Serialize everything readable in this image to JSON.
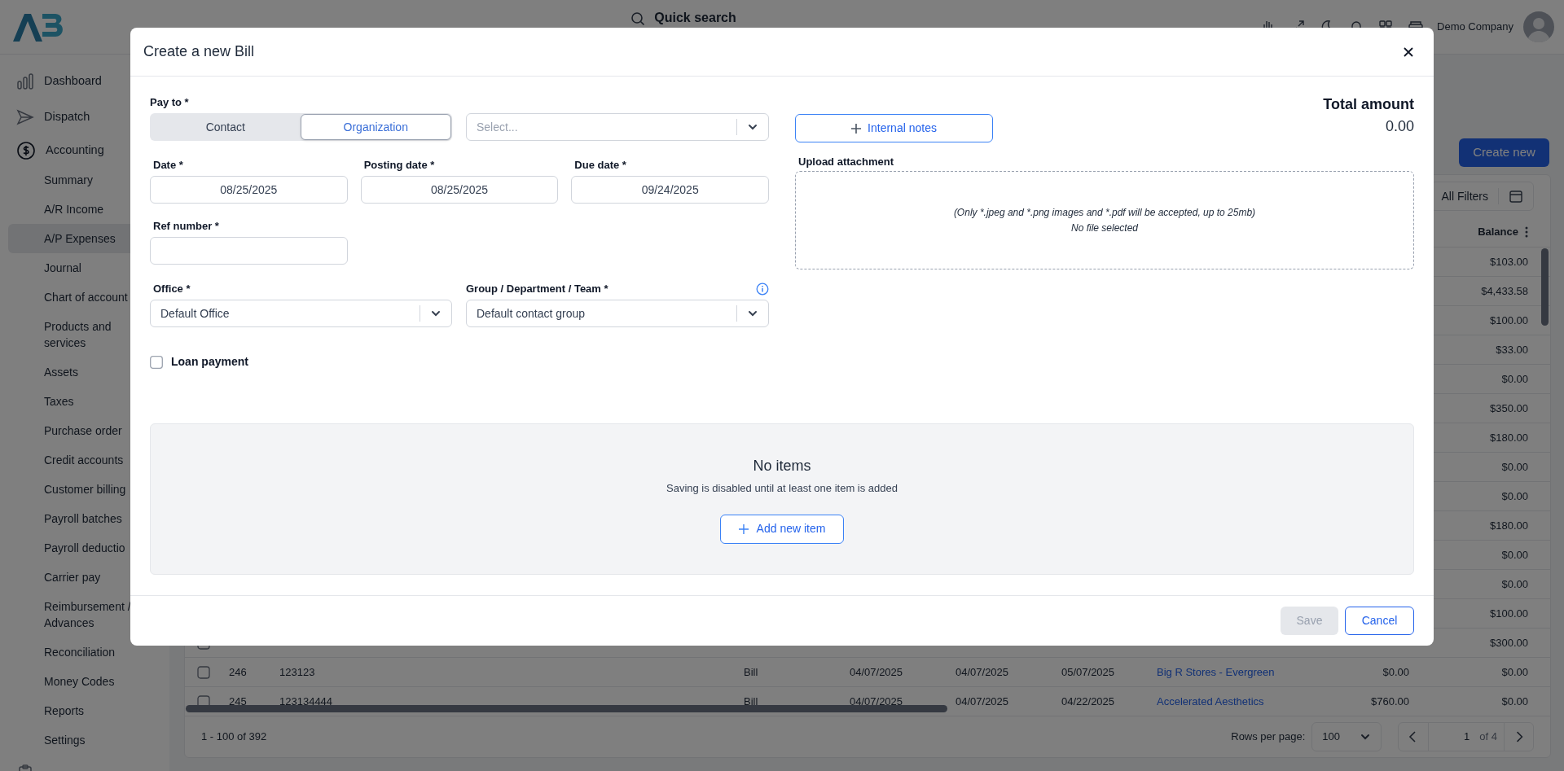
{
  "top_bar": {
    "search": "Quick search",
    "company": "Demo Company"
  },
  "sidebar": {
    "items": [
      {
        "label": "Dashboard",
        "selected": false
      },
      {
        "label": "Dispatch",
        "selected": false
      },
      {
        "label": "Accounting",
        "selected": false,
        "children": [
          {
            "label": "Summary",
            "selected": false
          },
          {
            "label": "A/R Income",
            "selected": false
          },
          {
            "label": "A/P Expenses",
            "selected": true
          },
          {
            "label": "Journal",
            "selected": false
          },
          {
            "label": "Chart of account",
            "selected": false
          },
          {
            "label": "Products and services",
            "selected": false
          },
          {
            "label": "Assets",
            "selected": false
          },
          {
            "label": "Taxes",
            "selected": false
          },
          {
            "label": "Purchase order",
            "selected": false
          },
          {
            "label": "Credit accounts",
            "selected": false
          },
          {
            "label": "Customer billing",
            "selected": false
          },
          {
            "label": "Payroll batches",
            "selected": false
          },
          {
            "label": "Payroll deductio",
            "selected": false
          },
          {
            "label": "Carrier pay",
            "selected": false
          },
          {
            "label": "Reimbursement / Advances",
            "selected": false
          },
          {
            "label": "Reconciliation",
            "selected": false
          },
          {
            "label": "Money Codes",
            "selected": false
          },
          {
            "label": "Reports",
            "selected": false
          },
          {
            "label": "Settings",
            "selected": false
          }
        ]
      },
      {
        "selected": false
      }
    ]
  },
  "create_button": "Create new",
  "filters_button": "All Filters",
  "table": {
    "balance_header": "Balance",
    "rows": [
      {
        "balance": "$103.00"
      },
      {
        "balance": "$4,433.58"
      },
      {
        "balance": "$100.00"
      },
      {
        "balance": "$33.00"
      },
      {
        "balance": "$0.00"
      },
      {
        "balance": "$350.00"
      },
      {
        "balance": "$180.00"
      },
      {
        "balance": "$0.00"
      },
      {
        "balance": "$0.00"
      },
      {
        "balance": "$180.00"
      },
      {
        "balance": "$0.00"
      },
      {
        "balance": "$0.00"
      },
      {
        "balance": "$100.00"
      },
      {
        "balance": "$300.00",
        "checked": false
      },
      {
        "checked": false,
        "column_2": "246",
        "column_3": "123123",
        "column_4": "Bill",
        "column_5": "04/07/2025",
        "column_6": "04/07/2025",
        "column_7": "05/07/2025",
        "column_8": "Big R Stores - Evergreen",
        "column_9": "$0.00",
        "balance": "$0.00"
      },
      {
        "checked": false,
        "column_2": "245",
        "column_3": "123134444",
        "column_4": "Bill",
        "column_5": "04/07/2025",
        "column_6": "04/07/2025",
        "column_7": "04/22/2025",
        "column_8": "Accelerated Aesthetics",
        "column_9": "$760.00",
        "balance": "$0.00"
      }
    ]
  },
  "pagination": {
    "range": "1 - 100 of 392",
    "rows_per_page_label": "Rows per page:",
    "rows_per_page": "100",
    "page": "1",
    "of_pages": "of 4"
  },
  "modal": {
    "title": "Create a new Bill",
    "pay_to": {
      "label": "Pay to *",
      "options": [
        {
          "label": "Contact",
          "selected": false
        },
        {
          "label": "Organization",
          "selected": true
        }
      ],
      "placeholder": "Select..."
    },
    "dates": [
      {
        "label": "Date *",
        "value": "08/25/2025"
      },
      {
        "label": "Posting date *",
        "value": "08/25/2025"
      },
      {
        "label": "Due date *",
        "value": "09/24/2025"
      }
    ],
    "ref_number": {
      "label": "Ref number *"
    },
    "office": {
      "label": "Office *",
      "value": "Default Office"
    },
    "group": {
      "label": "Group / Department / Team *",
      "value": "Default contact group"
    },
    "loan_payment": {
      "label": "Loan payment",
      "checked": false
    },
    "internal_notes": "Internal notes",
    "total": {
      "label": "Total amount",
      "value": "0.00"
    },
    "upload": {
      "label": "Upload attachment",
      "hint": "(Only *.jpeg and *.png images and *.pdf will be accepted, up to 25mb)",
      "status": "No file selected"
    },
    "items": {
      "title": "No items",
      "message": "Saving is disabled until at least one item is added",
      "add_button": "Add new item"
    },
    "buttons": [
      {
        "label": "Save",
        "disabled": true
      },
      {
        "label": "Cancel",
        "disabled": false
      }
    ]
  }
}
